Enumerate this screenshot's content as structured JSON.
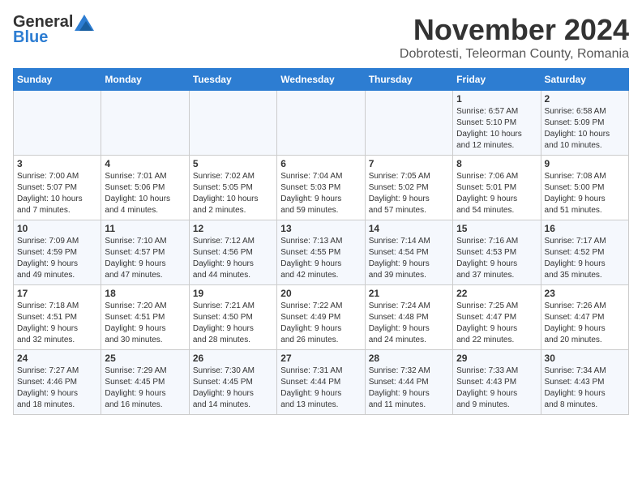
{
  "header": {
    "logo_line1": "General",
    "logo_line2": "Blue",
    "month": "November 2024",
    "location": "Dobrotesti, Teleorman County, Romania"
  },
  "weekdays": [
    "Sunday",
    "Monday",
    "Tuesday",
    "Wednesday",
    "Thursday",
    "Friday",
    "Saturday"
  ],
  "weeks": [
    [
      {
        "day": "",
        "info": ""
      },
      {
        "day": "",
        "info": ""
      },
      {
        "day": "",
        "info": ""
      },
      {
        "day": "",
        "info": ""
      },
      {
        "day": "",
        "info": ""
      },
      {
        "day": "1",
        "info": "Sunrise: 6:57 AM\nSunset: 5:10 PM\nDaylight: 10 hours\nand 12 minutes."
      },
      {
        "day": "2",
        "info": "Sunrise: 6:58 AM\nSunset: 5:09 PM\nDaylight: 10 hours\nand 10 minutes."
      }
    ],
    [
      {
        "day": "3",
        "info": "Sunrise: 7:00 AM\nSunset: 5:07 PM\nDaylight: 10 hours\nand 7 minutes."
      },
      {
        "day": "4",
        "info": "Sunrise: 7:01 AM\nSunset: 5:06 PM\nDaylight: 10 hours\nand 4 minutes."
      },
      {
        "day": "5",
        "info": "Sunrise: 7:02 AM\nSunset: 5:05 PM\nDaylight: 10 hours\nand 2 minutes."
      },
      {
        "day": "6",
        "info": "Sunrise: 7:04 AM\nSunset: 5:03 PM\nDaylight: 9 hours\nand 59 minutes."
      },
      {
        "day": "7",
        "info": "Sunrise: 7:05 AM\nSunset: 5:02 PM\nDaylight: 9 hours\nand 57 minutes."
      },
      {
        "day": "8",
        "info": "Sunrise: 7:06 AM\nSunset: 5:01 PM\nDaylight: 9 hours\nand 54 minutes."
      },
      {
        "day": "9",
        "info": "Sunrise: 7:08 AM\nSunset: 5:00 PM\nDaylight: 9 hours\nand 51 minutes."
      }
    ],
    [
      {
        "day": "10",
        "info": "Sunrise: 7:09 AM\nSunset: 4:59 PM\nDaylight: 9 hours\nand 49 minutes."
      },
      {
        "day": "11",
        "info": "Sunrise: 7:10 AM\nSunset: 4:57 PM\nDaylight: 9 hours\nand 47 minutes."
      },
      {
        "day": "12",
        "info": "Sunrise: 7:12 AM\nSunset: 4:56 PM\nDaylight: 9 hours\nand 44 minutes."
      },
      {
        "day": "13",
        "info": "Sunrise: 7:13 AM\nSunset: 4:55 PM\nDaylight: 9 hours\nand 42 minutes."
      },
      {
        "day": "14",
        "info": "Sunrise: 7:14 AM\nSunset: 4:54 PM\nDaylight: 9 hours\nand 39 minutes."
      },
      {
        "day": "15",
        "info": "Sunrise: 7:16 AM\nSunset: 4:53 PM\nDaylight: 9 hours\nand 37 minutes."
      },
      {
        "day": "16",
        "info": "Sunrise: 7:17 AM\nSunset: 4:52 PM\nDaylight: 9 hours\nand 35 minutes."
      }
    ],
    [
      {
        "day": "17",
        "info": "Sunrise: 7:18 AM\nSunset: 4:51 PM\nDaylight: 9 hours\nand 32 minutes."
      },
      {
        "day": "18",
        "info": "Sunrise: 7:20 AM\nSunset: 4:51 PM\nDaylight: 9 hours\nand 30 minutes."
      },
      {
        "day": "19",
        "info": "Sunrise: 7:21 AM\nSunset: 4:50 PM\nDaylight: 9 hours\nand 28 minutes."
      },
      {
        "day": "20",
        "info": "Sunrise: 7:22 AM\nSunset: 4:49 PM\nDaylight: 9 hours\nand 26 minutes."
      },
      {
        "day": "21",
        "info": "Sunrise: 7:24 AM\nSunset: 4:48 PM\nDaylight: 9 hours\nand 24 minutes."
      },
      {
        "day": "22",
        "info": "Sunrise: 7:25 AM\nSunset: 4:47 PM\nDaylight: 9 hours\nand 22 minutes."
      },
      {
        "day": "23",
        "info": "Sunrise: 7:26 AM\nSunset: 4:47 PM\nDaylight: 9 hours\nand 20 minutes."
      }
    ],
    [
      {
        "day": "24",
        "info": "Sunrise: 7:27 AM\nSunset: 4:46 PM\nDaylight: 9 hours\nand 18 minutes."
      },
      {
        "day": "25",
        "info": "Sunrise: 7:29 AM\nSunset: 4:45 PM\nDaylight: 9 hours\nand 16 minutes."
      },
      {
        "day": "26",
        "info": "Sunrise: 7:30 AM\nSunset: 4:45 PM\nDaylight: 9 hours\nand 14 minutes."
      },
      {
        "day": "27",
        "info": "Sunrise: 7:31 AM\nSunset: 4:44 PM\nDaylight: 9 hours\nand 13 minutes."
      },
      {
        "day": "28",
        "info": "Sunrise: 7:32 AM\nSunset: 4:44 PM\nDaylight: 9 hours\nand 11 minutes."
      },
      {
        "day": "29",
        "info": "Sunrise: 7:33 AM\nSunset: 4:43 PM\nDaylight: 9 hours\nand 9 minutes."
      },
      {
        "day": "30",
        "info": "Sunrise: 7:34 AM\nSunset: 4:43 PM\nDaylight: 9 hours\nand 8 minutes."
      }
    ]
  ]
}
